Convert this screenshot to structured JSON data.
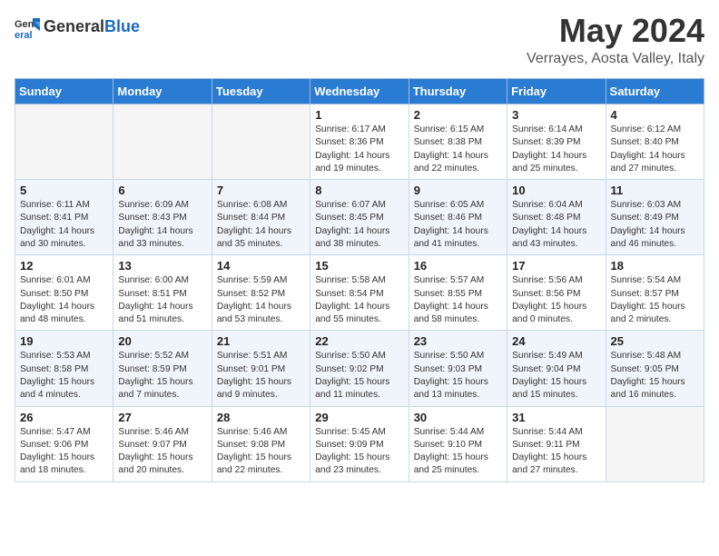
{
  "header": {
    "logo_line1": "General",
    "logo_line2": "Blue",
    "month": "May 2024",
    "location": "Verrayes, Aosta Valley, Italy"
  },
  "days_of_week": [
    "Sunday",
    "Monday",
    "Tuesday",
    "Wednesday",
    "Thursday",
    "Friday",
    "Saturday"
  ],
  "weeks": [
    [
      {
        "day": "",
        "text": ""
      },
      {
        "day": "",
        "text": ""
      },
      {
        "day": "",
        "text": ""
      },
      {
        "day": "1",
        "text": "Sunrise: 6:17 AM\nSunset: 8:36 PM\nDaylight: 14 hours\nand 19 minutes."
      },
      {
        "day": "2",
        "text": "Sunrise: 6:15 AM\nSunset: 8:38 PM\nDaylight: 14 hours\nand 22 minutes."
      },
      {
        "day": "3",
        "text": "Sunrise: 6:14 AM\nSunset: 8:39 PM\nDaylight: 14 hours\nand 25 minutes."
      },
      {
        "day": "4",
        "text": "Sunrise: 6:12 AM\nSunset: 8:40 PM\nDaylight: 14 hours\nand 27 minutes."
      }
    ],
    [
      {
        "day": "5",
        "text": "Sunrise: 6:11 AM\nSunset: 8:41 PM\nDaylight: 14 hours\nand 30 minutes."
      },
      {
        "day": "6",
        "text": "Sunrise: 6:09 AM\nSunset: 8:43 PM\nDaylight: 14 hours\nand 33 minutes."
      },
      {
        "day": "7",
        "text": "Sunrise: 6:08 AM\nSunset: 8:44 PM\nDaylight: 14 hours\nand 35 minutes."
      },
      {
        "day": "8",
        "text": "Sunrise: 6:07 AM\nSunset: 8:45 PM\nDaylight: 14 hours\nand 38 minutes."
      },
      {
        "day": "9",
        "text": "Sunrise: 6:05 AM\nSunset: 8:46 PM\nDaylight: 14 hours\nand 41 minutes."
      },
      {
        "day": "10",
        "text": "Sunrise: 6:04 AM\nSunset: 8:48 PM\nDaylight: 14 hours\nand 43 minutes."
      },
      {
        "day": "11",
        "text": "Sunrise: 6:03 AM\nSunset: 8:49 PM\nDaylight: 14 hours\nand 46 minutes."
      }
    ],
    [
      {
        "day": "12",
        "text": "Sunrise: 6:01 AM\nSunset: 8:50 PM\nDaylight: 14 hours\nand 48 minutes."
      },
      {
        "day": "13",
        "text": "Sunrise: 6:00 AM\nSunset: 8:51 PM\nDaylight: 14 hours\nand 51 minutes."
      },
      {
        "day": "14",
        "text": "Sunrise: 5:59 AM\nSunset: 8:52 PM\nDaylight: 14 hours\nand 53 minutes."
      },
      {
        "day": "15",
        "text": "Sunrise: 5:58 AM\nSunset: 8:54 PM\nDaylight: 14 hours\nand 55 minutes."
      },
      {
        "day": "16",
        "text": "Sunrise: 5:57 AM\nSunset: 8:55 PM\nDaylight: 14 hours\nand 58 minutes."
      },
      {
        "day": "17",
        "text": "Sunrise: 5:56 AM\nSunset: 8:56 PM\nDaylight: 15 hours\nand 0 minutes."
      },
      {
        "day": "18",
        "text": "Sunrise: 5:54 AM\nSunset: 8:57 PM\nDaylight: 15 hours\nand 2 minutes."
      }
    ],
    [
      {
        "day": "19",
        "text": "Sunrise: 5:53 AM\nSunset: 8:58 PM\nDaylight: 15 hours\nand 4 minutes."
      },
      {
        "day": "20",
        "text": "Sunrise: 5:52 AM\nSunset: 8:59 PM\nDaylight: 15 hours\nand 7 minutes."
      },
      {
        "day": "21",
        "text": "Sunrise: 5:51 AM\nSunset: 9:01 PM\nDaylight: 15 hours\nand 9 minutes."
      },
      {
        "day": "22",
        "text": "Sunrise: 5:50 AM\nSunset: 9:02 PM\nDaylight: 15 hours\nand 11 minutes."
      },
      {
        "day": "23",
        "text": "Sunrise: 5:50 AM\nSunset: 9:03 PM\nDaylight: 15 hours\nand 13 minutes."
      },
      {
        "day": "24",
        "text": "Sunrise: 5:49 AM\nSunset: 9:04 PM\nDaylight: 15 hours\nand 15 minutes."
      },
      {
        "day": "25",
        "text": "Sunrise: 5:48 AM\nSunset: 9:05 PM\nDaylight: 15 hours\nand 16 minutes."
      }
    ],
    [
      {
        "day": "26",
        "text": "Sunrise: 5:47 AM\nSunset: 9:06 PM\nDaylight: 15 hours\nand 18 minutes."
      },
      {
        "day": "27",
        "text": "Sunrise: 5:46 AM\nSunset: 9:07 PM\nDaylight: 15 hours\nand 20 minutes."
      },
      {
        "day": "28",
        "text": "Sunrise: 5:46 AM\nSunset: 9:08 PM\nDaylight: 15 hours\nand 22 minutes."
      },
      {
        "day": "29",
        "text": "Sunrise: 5:45 AM\nSunset: 9:09 PM\nDaylight: 15 hours\nand 23 minutes."
      },
      {
        "day": "30",
        "text": "Sunrise: 5:44 AM\nSunset: 9:10 PM\nDaylight: 15 hours\nand 25 minutes."
      },
      {
        "day": "31",
        "text": "Sunrise: 5:44 AM\nSunset: 9:11 PM\nDaylight: 15 hours\nand 27 minutes."
      },
      {
        "day": "",
        "text": ""
      }
    ]
  ]
}
